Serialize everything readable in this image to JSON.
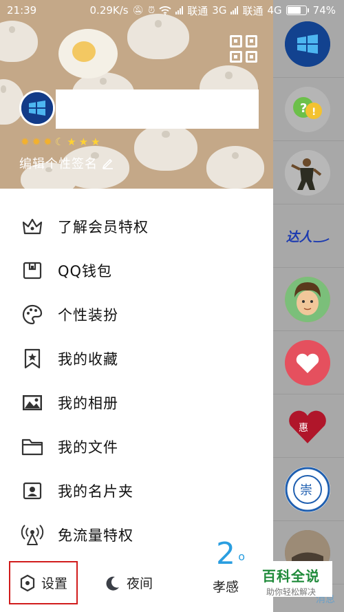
{
  "status_bar": {
    "time": "21:39",
    "speed": "0.29K/s",
    "carrier1": "联通",
    "net1": "3G",
    "carrier2": "联通",
    "net2": "4G",
    "battery": "74%",
    "battery_level": 0.74
  },
  "header": {
    "signature": "编辑个性签名",
    "level_icons": [
      "sun",
      "sun",
      "sun",
      "moon",
      "star",
      "star",
      "star"
    ]
  },
  "menu": {
    "items": [
      {
        "label": "了解会员特权",
        "icon": "crown-icon"
      },
      {
        "label": "QQ钱包",
        "icon": "wallet-icon"
      },
      {
        "label": "个性装扮",
        "icon": "palette-icon"
      },
      {
        "label": "我的收藏",
        "icon": "bookmark-star-icon"
      },
      {
        "label": "我的相册",
        "icon": "image-icon"
      },
      {
        "label": "我的文件",
        "icon": "folder-icon"
      },
      {
        "label": "我的名片夹",
        "icon": "contact-card-icon"
      },
      {
        "label": "免流量特权",
        "icon": "signal-tower-icon"
      }
    ]
  },
  "bottom_bar": {
    "settings": "设置",
    "night": "夜间",
    "temperature": "2",
    "temperature_unit": "o",
    "city": "孝感"
  },
  "peek": {
    "tab_label": "消息"
  },
  "watermark": {
    "title": "百科全说",
    "subtitle": "助你轻松解决"
  },
  "colors": {
    "header_bg": "#c4a888",
    "accent_blue": "#2a9ee0",
    "highlight_red": "#d11b1b",
    "watermark_green": "#1f8a3a"
  }
}
